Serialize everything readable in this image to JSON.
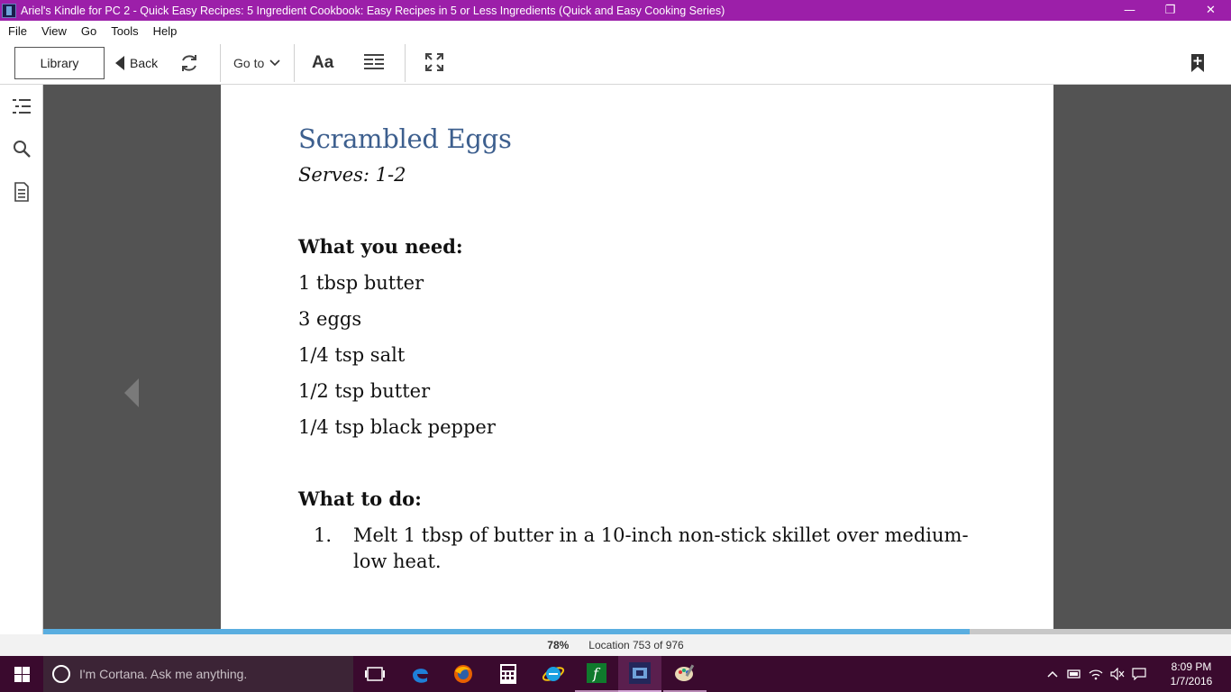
{
  "window": {
    "title": "Ariel's Kindle for PC 2 - Quick Easy Recipes: 5 Ingredient Cookbook: Easy Recipes in 5 or Less Ingredients (Quick and Easy Cooking Series)",
    "minimize_glyph": "—",
    "restore_glyph": "❐",
    "close_glyph": "✕"
  },
  "menu": {
    "file": "File",
    "view": "View",
    "go": "Go",
    "tools": "Tools",
    "help": "Help"
  },
  "toolbar": {
    "library_label": "Library",
    "back_label": "Back",
    "goto_label": "Go to",
    "font_label": "Aa"
  },
  "page": {
    "title": "Scrambled Eggs",
    "serves": "Serves: 1-2",
    "need_heading": "What you need:",
    "ingredients": [
      "1 tbsp butter",
      "3 eggs",
      "1/4 tsp salt",
      "1/2 tsp butter",
      "1/4 tsp black pepper"
    ],
    "do_heading": "What to do:",
    "steps": [
      {
        "num": "1.",
        "text": "Melt 1 tbsp of butter in a 10-inch non-stick skillet over medium-low heat."
      }
    ]
  },
  "status": {
    "percent_label": "78%",
    "progress_fraction": 0.78,
    "location": "Location 753 of 976"
  },
  "taskbar": {
    "cortana_placeholder": "I'm Cortana. Ask me anything.",
    "time": "8:09 PM",
    "date": "1/7/2016",
    "icons": [
      "task-view-icon",
      "edge-icon",
      "firefox-icon",
      "calculator-icon",
      "internet-explorer-icon",
      "formula-app-icon",
      "kindle-icon",
      "paint-icon"
    ]
  },
  "colors": {
    "titlebar": "#9c1fa9",
    "heading_blue": "#3d5f8e",
    "progress": "#5aaee0",
    "reading_bg": "#535353"
  }
}
